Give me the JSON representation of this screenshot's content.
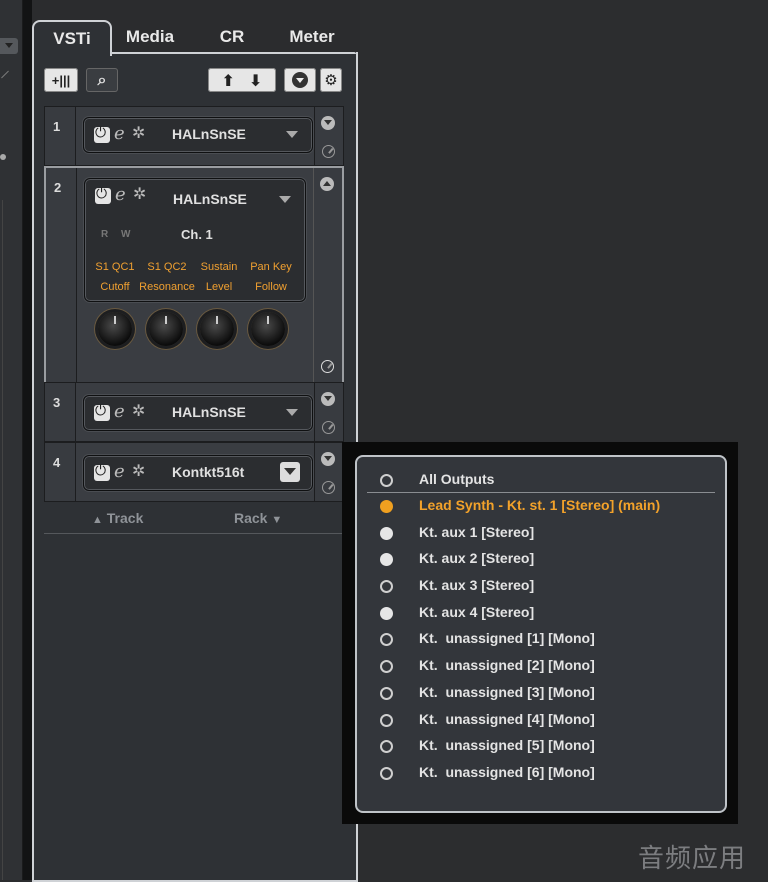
{
  "tabs": [
    {
      "label": "VSTi",
      "active": true
    },
    {
      "label": "Media",
      "active": false
    },
    {
      "label": "CR",
      "active": false
    },
    {
      "label": "Meter",
      "active": false
    }
  ],
  "toolbar": {
    "add_instrument_glyph": "+|||",
    "search_glyph": "⌕",
    "up_glyph": "⬆",
    "down_glyph": "⬇"
  },
  "slots": [
    {
      "number": "1",
      "instrument": "HALnSnSE"
    },
    {
      "number": "2",
      "instrument": "HALnSnSE",
      "channel": "Ch. 1",
      "rw": [
        "R",
        "W"
      ],
      "quick_controls": [
        {
          "line1": "S1 QC1",
          "line2": "Cutoff"
        },
        {
          "line1": "S1 QC2",
          "line2": "Resonance"
        },
        {
          "line1": "Sustain",
          "line2": "Level"
        },
        {
          "line1": "Pan Key",
          "line2": "Follow"
        }
      ]
    },
    {
      "number": "3",
      "instrument": "HALnSnSE"
    },
    {
      "number": "4",
      "instrument": "Kontkt516t"
    }
  ],
  "footer": {
    "track_label": "Track",
    "rack_label": "Rack"
  },
  "outputs_menu": {
    "items": [
      {
        "label": "All Outputs",
        "state": "empty"
      },
      {
        "label": "Lead Synth - Kt. st. 1 [Stereo] (main)",
        "state": "selected"
      },
      {
        "label": "Kt. aux 1 [Stereo]",
        "state": "filled"
      },
      {
        "label": "Kt. aux 2 [Stereo]",
        "state": "filled"
      },
      {
        "label": "Kt. aux 3 [Stereo]",
        "state": "empty"
      },
      {
        "label": "Kt. aux 4 [Stereo]",
        "state": "filled"
      },
      {
        "label": "Kt.  unassigned [1] [Mono]",
        "state": "empty"
      },
      {
        "label": "Kt.  unassigned [2] [Mono]",
        "state": "empty"
      },
      {
        "label": "Kt.  unassigned [3] [Mono]",
        "state": "empty"
      },
      {
        "label": "Kt.  unassigned [4] [Mono]",
        "state": "empty"
      },
      {
        "label": "Kt.  unassigned [5] [Mono]",
        "state": "empty"
      },
      {
        "label": "Kt.  unassigned [6] [Mono]",
        "state": "empty"
      }
    ]
  },
  "watermark": "音频应用",
  "colors": {
    "accent": "#f3a22a",
    "panel": "#2e3135",
    "border": "#cfd2d6"
  }
}
